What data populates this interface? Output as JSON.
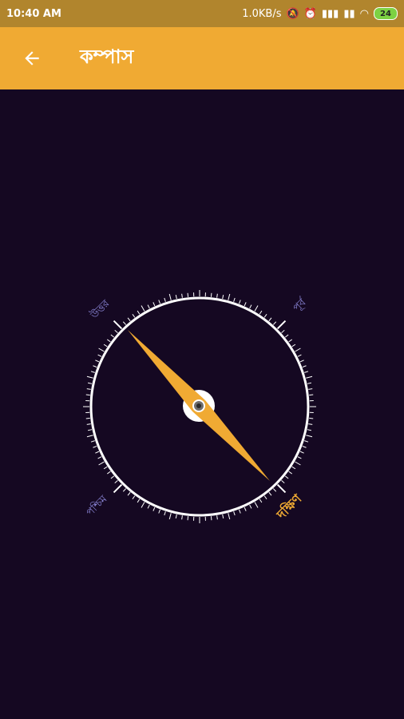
{
  "status_bar": {
    "time": "10:40 AM",
    "network_speed": "1.0KB/s",
    "battery": "24",
    "icons": [
      "notifications-off-icon",
      "alarm-icon",
      "signal-icon",
      "signal-icon",
      "wifi-icon",
      "battery-icon"
    ]
  },
  "app_bar": {
    "back_icon": "arrow-left-icon",
    "title": "কম্পাস"
  },
  "compass": {
    "labels": {
      "north": "উত্তর",
      "east": "পূর্ব",
      "south": "দক্ষিণ",
      "west": "পশ্চিম"
    },
    "needle_color": "#f0aa33",
    "background": "#150822",
    "ring_color": "#ffffff",
    "label_color": "#8b86d8"
  }
}
